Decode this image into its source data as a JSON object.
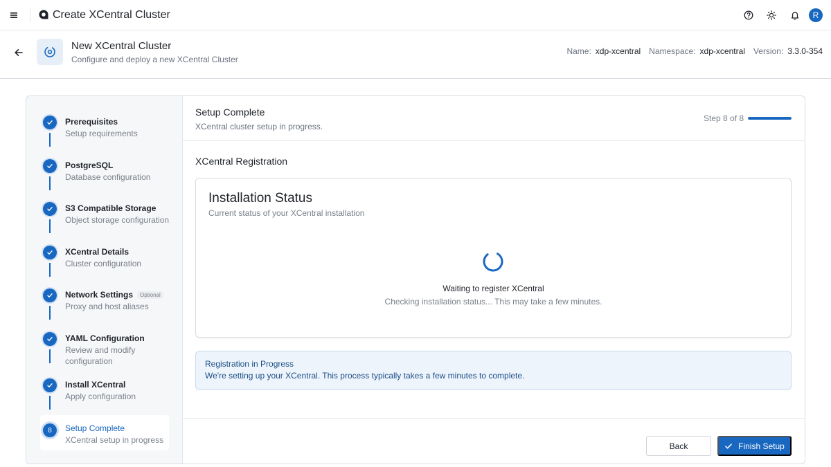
{
  "topbar": {
    "title": "Create XCentral Cluster",
    "avatar_initial": "R"
  },
  "header": {
    "title": "New XCentral Cluster",
    "subtitle": "Configure and deploy a new XCentral Cluster",
    "name_label": "Name:",
    "name_value": "xdp-xcentral",
    "namespace_label": "Namespace:",
    "namespace_value": "xdp-xcentral",
    "version_label": "Version:",
    "version_value": "3.3.0-354"
  },
  "steps": [
    {
      "title": "Prerequisites",
      "desc": "Setup requirements",
      "status": "done"
    },
    {
      "title": "PostgreSQL",
      "desc": "Database configuration",
      "status": "done"
    },
    {
      "title": "S3 Compatible Storage",
      "desc": "Object storage configuration",
      "status": "done"
    },
    {
      "title": "XCentral Details",
      "desc": "Cluster configuration",
      "status": "done"
    },
    {
      "title": "Network Settings",
      "badge": "Optional",
      "desc": "Proxy and host aliases",
      "status": "done"
    },
    {
      "title": "YAML Configuration",
      "desc": "Review and modify configuration",
      "status": "done"
    },
    {
      "title": "Install XCentral",
      "desc": "Apply configuration",
      "status": "done"
    },
    {
      "title": "Setup Complete",
      "desc": "XCentral setup in progress",
      "status": "active",
      "number": "8"
    }
  ],
  "main": {
    "title": "Setup Complete",
    "subtitle": "XCentral cluster setup in progress.",
    "step_indicator": "Step 8 of 8",
    "progress": 1.0,
    "section_title": "XCentral Registration",
    "status_card": {
      "title": "Installation Status",
      "subtitle": "Current status of your XCentral installation",
      "waiting": "Waiting to register XCentral",
      "checking": "Checking installation status... This may take a few minutes."
    },
    "info": {
      "title": "Registration in Progress",
      "desc": "We're setting up your XCentral. This process typically takes a few minutes to complete."
    },
    "back_label": "Back",
    "finish_label": "Finish Setup"
  },
  "colors": {
    "accent": "#1867c0",
    "info_bg": "#eef4fb"
  }
}
